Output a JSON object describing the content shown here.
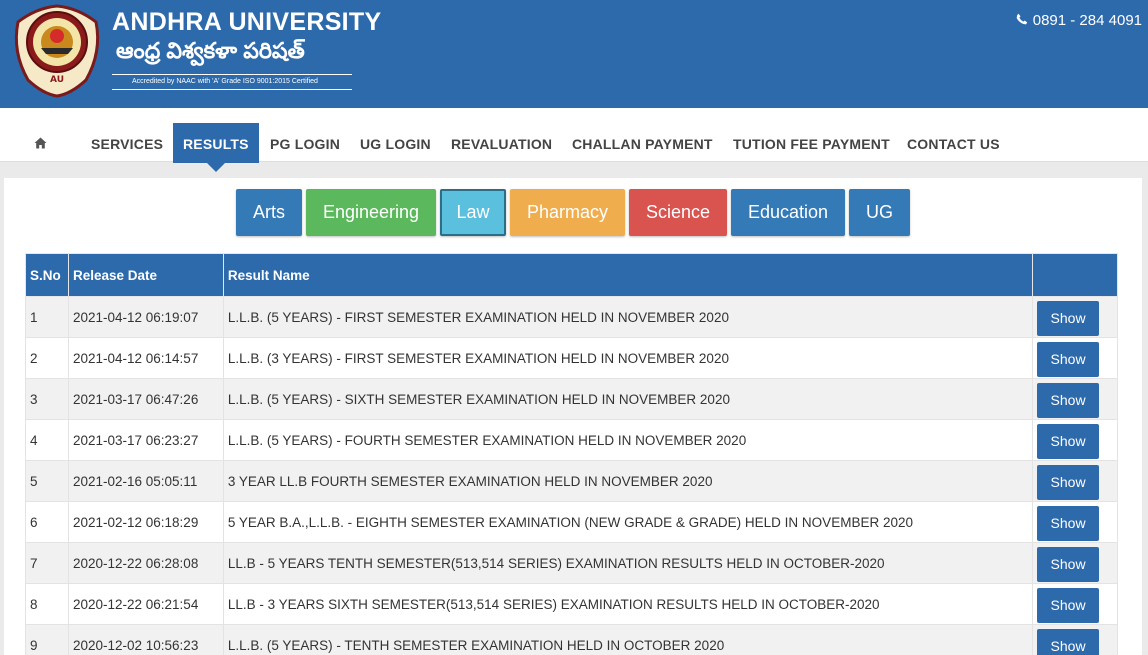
{
  "header": {
    "title": "ANDHRA UNIVERSITY",
    "title_telugu": "ఆంధ్ర విశ్వకళా పరిషత్",
    "accreditation": "Accredited by NAAC with 'A' Grade ISO 9001:2015 Certified",
    "phone": "0891 - 284 4091",
    "brand_color": "#2d6aab"
  },
  "nav": {
    "home_icon": "home-icon",
    "items": [
      {
        "label": "SERVICES"
      },
      {
        "label": "RESULTS"
      },
      {
        "label": "PG LOGIN"
      },
      {
        "label": "UG LOGIN"
      },
      {
        "label": "REVALUATION"
      },
      {
        "label": "CHALLAN PAYMENT"
      },
      {
        "label": "TUTION FEE PAYMENT"
      },
      {
        "label": "CONTACT US"
      }
    ],
    "active": "RESULTS"
  },
  "categories": [
    {
      "label": "Arts",
      "color": "#337ab7"
    },
    {
      "label": "Engineering",
      "color": "#5cb85c"
    },
    {
      "label": "Law",
      "color": "#5bc0de"
    },
    {
      "label": "Pharmacy",
      "color": "#f0ad4e"
    },
    {
      "label": "Science",
      "color": "#d9534f"
    },
    {
      "label": "Education",
      "color": "#337ab7"
    },
    {
      "label": "UG",
      "color": "#337ab7"
    }
  ],
  "table": {
    "headers": [
      "S.No",
      "Release Date",
      "Result Name",
      ""
    ],
    "show_label": "Show",
    "rows": [
      {
        "sno": "1",
        "date": "2021-04-12 06:19:07",
        "name": "L.L.B. (5 YEARS) - FIRST SEMESTER EXAMINATION HELD IN NOVEMBER 2020"
      },
      {
        "sno": "2",
        "date": "2021-04-12 06:14:57",
        "name": "L.L.B. (3 YEARS) - FIRST SEMESTER EXAMINATION HELD IN NOVEMBER 2020"
      },
      {
        "sno": "3",
        "date": "2021-03-17 06:47:26",
        "name": "L.L.B. (5 YEARS) - SIXTH SEMESTER EXAMINATION HELD IN NOVEMBER 2020"
      },
      {
        "sno": "4",
        "date": "2021-03-17 06:23:27",
        "name": "L.L.B. (5 YEARS) - FOURTH SEMESTER EXAMINATION HELD IN NOVEMBER 2020"
      },
      {
        "sno": "5",
        "date": "2021-02-16 05:05:11",
        "name": "3 YEAR LL.B FOURTH SEMESTER EXAMINATION HELD IN NOVEMBER 2020"
      },
      {
        "sno": "6",
        "date": "2021-02-12 06:18:29",
        "name": "5 YEAR B.A.,L.L.B. - EIGHTH SEMESTER EXAMINATION (NEW GRADE & GRADE) HELD IN NOVEMBER 2020"
      },
      {
        "sno": "7",
        "date": "2020-12-22 06:28:08",
        "name": "LL.B - 5 YEARS TENTH SEMESTER(513,514 SERIES) EXAMINATION RESULTS HELD IN OCTOBER-2020"
      },
      {
        "sno": "8",
        "date": "2020-12-22 06:21:54",
        "name": "LL.B - 3 YEARS SIXTH SEMESTER(513,514 SERIES) EXAMINATION RESULTS HELD IN OCTOBER-2020"
      },
      {
        "sno": "9",
        "date": "2020-12-02 10:56:23",
        "name": "L.L.B. (5 YEARS) - TENTH SEMESTER EXAMINATION HELD IN OCTOBER 2020"
      }
    ]
  }
}
